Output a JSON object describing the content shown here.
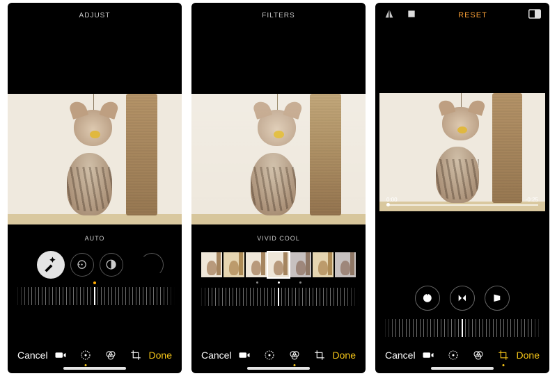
{
  "colors": {
    "accent": "#f5c518",
    "reset": "#f59d36"
  },
  "bottom": {
    "cancel": "Cancel",
    "done": "Done"
  },
  "modes": {
    "video": "video-icon",
    "adjust": "adjust-icon",
    "filters": "filters-icon",
    "crop": "crop-icon"
  },
  "screen_adjust": {
    "title": "ADJUST",
    "caption": "AUTO",
    "tools": [
      "auto-enhance-icon",
      "exposure-icon",
      "contrast-icon"
    ],
    "active_mode": "adjust"
  },
  "screen_filters": {
    "title": "FILTERS",
    "caption": "VIVID COOL",
    "filters": [
      {
        "id": "original"
      },
      {
        "id": "vivid"
      },
      {
        "id": "vivid-warm"
      },
      {
        "id": "vivid-cool",
        "selected": true
      },
      {
        "id": "dramatic"
      },
      {
        "id": "dramatic-warm"
      },
      {
        "id": "dramatic-cool"
      }
    ],
    "active_mode": "filters"
  },
  "screen_crop": {
    "reset": "RESET",
    "topbar_icons": [
      "flip-icon",
      "rotate-icon",
      "aspect-ratio-icon"
    ],
    "video": {
      "current": "0:00",
      "duration": "-0:25"
    },
    "tools": [
      "straighten-icon",
      "flip-horizontal-icon",
      "perspective-icon"
    ],
    "active_mode": "crop"
  }
}
